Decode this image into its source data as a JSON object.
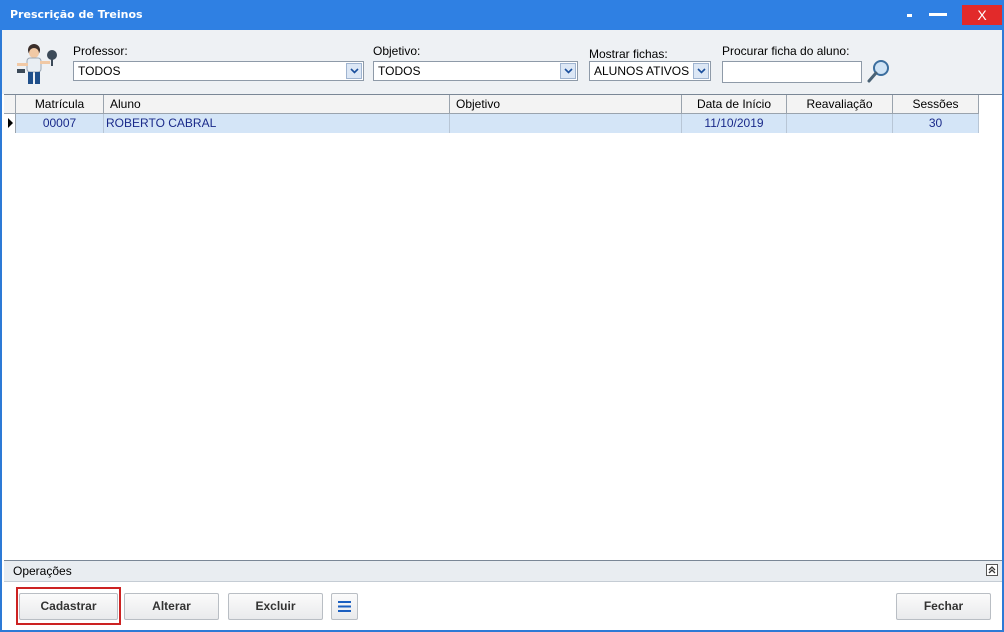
{
  "window": {
    "title": "Prescrição de Treinos",
    "close_label": "X"
  },
  "filters": {
    "professor": {
      "label": "Professor:",
      "value": "TODOS"
    },
    "objetivo": {
      "label": "Objetivo:",
      "value": "TODOS"
    },
    "mostrar_fichas": {
      "label": "Mostrar fichas:",
      "value": "ALUNOS ATIVOS"
    },
    "procurar": {
      "label": "Procurar ficha do aluno:",
      "value": ""
    }
  },
  "grid": {
    "columns": [
      "Matrícula",
      "Aluno",
      "Objetivo",
      "Data de Início",
      "Reavaliação",
      "Sessões"
    ],
    "rows": [
      {
        "matricula": "00007",
        "aluno": "ROBERTO CABRAL",
        "objetivo": "",
        "data_inicio": "11/10/2019",
        "reavaliacao": "",
        "sessoes": "30"
      }
    ]
  },
  "operations": {
    "label": "Operações",
    "cadastrar": "Cadastrar",
    "alterar": "Alterar",
    "excluir": "Excluir",
    "fechar": "Fechar"
  },
  "colors": {
    "titlebar": "#2f80e3",
    "close": "#e22a2a",
    "selected_row": "#d4e5f7",
    "highlight": "#cc2222"
  }
}
